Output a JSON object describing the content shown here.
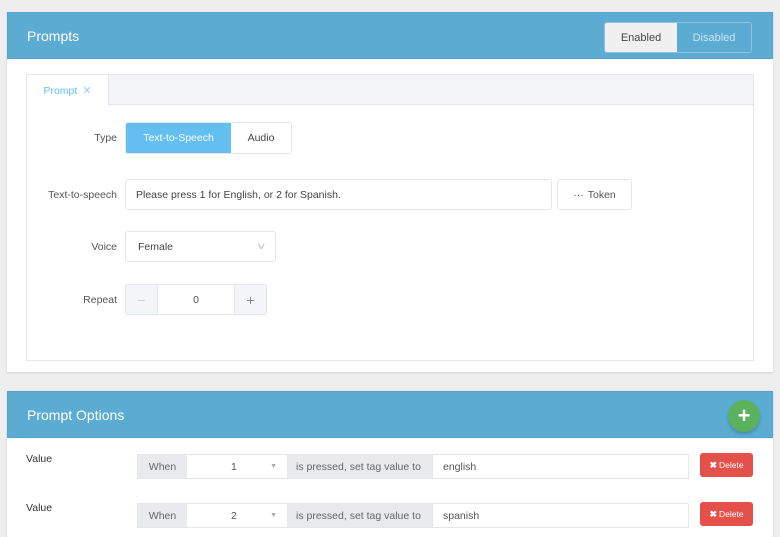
{
  "prompts_card": {
    "title": "Prompts",
    "toggle": {
      "enabled_label": "Enabled",
      "disabled_label": "Disabled",
      "selected": "Enabled"
    },
    "tab": {
      "label": "Prompt",
      "close_icon": "close-icon"
    },
    "type": {
      "label": "Type",
      "options": [
        "Text-to-Speech",
        "Audio"
      ],
      "selected": "Text-to-Speech"
    },
    "tts": {
      "label": "Text-to-speech",
      "value": "Please press 1 for English, or 2 for Spanish.",
      "token_icon": "ellipsis-icon",
      "token_label": "Token"
    },
    "voice": {
      "label": "Voice",
      "value": "Female",
      "icon": "chevron-down-icon"
    },
    "repeat": {
      "label": "Repeat",
      "value": "0",
      "minus": "−",
      "plus": "+"
    }
  },
  "options_card": {
    "title": "Prompt Options",
    "add_icon": "plus-icon",
    "rows": [
      {
        "label": "Value",
        "when": "When",
        "key": "1",
        "middle": "is pressed, set tag value to",
        "tag": "english",
        "delete_label": "Delete"
      },
      {
        "label": "Value",
        "when": "When",
        "key": "2",
        "middle": "is pressed, set tag value to",
        "tag": "spanish",
        "delete_label": "Delete"
      }
    ]
  },
  "colors": {
    "header": "#5babd3",
    "active": "#62bff0",
    "add": "#5ab25c",
    "delete": "#e4504a",
    "background": "#eeeeee"
  }
}
